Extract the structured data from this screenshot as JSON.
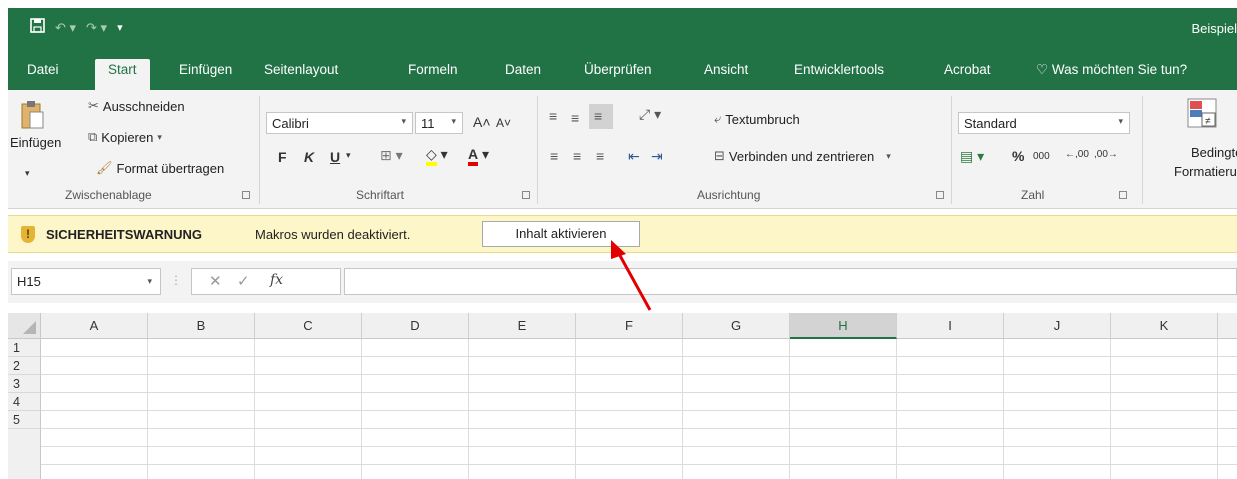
{
  "window": {
    "title": "Beispiel"
  },
  "tabs": [
    {
      "label": "Datei"
    },
    {
      "label": "Start"
    },
    {
      "label": "Einfügen"
    },
    {
      "label": "Seitenlayout"
    },
    {
      "label": "Formeln"
    },
    {
      "label": "Daten"
    },
    {
      "label": "Überprüfen"
    },
    {
      "label": "Ansicht"
    },
    {
      "label": "Entwicklertools"
    },
    {
      "label": "Acrobat"
    },
    {
      "label": "Was möchten Sie tun?"
    }
  ],
  "clipboard": {
    "group_label": "Zwischenablage",
    "paste": "Einfügen",
    "cut": "Ausschneiden",
    "copy": "Kopieren",
    "format_painter": "Format übertragen"
  },
  "font": {
    "group_label": "Schriftart",
    "name": "Calibri",
    "size": "11",
    "bold": "F",
    "italic": "K",
    "underline": "U"
  },
  "alignment": {
    "group_label": "Ausrichtung",
    "wrap_text": "Textumbruch",
    "merge_center": "Verbinden und zentrieren"
  },
  "number": {
    "group_label": "Zahl",
    "format": "Standard",
    "percent": "%",
    "thousands": "000",
    "inc_decimal": ",00",
    "dec_decimal": ",00"
  },
  "styles": {
    "conditional_format_1": "Bedingte",
    "conditional_format_2": "Formatierung"
  },
  "message_bar": {
    "title": "SICHERHEITSWARNUNG",
    "text": "Makros wurden deaktiviert.",
    "button": "Inhalt aktivieren"
  },
  "formula_bar": {
    "name_box": "H15",
    "fx": "fx",
    "formula": ""
  },
  "grid": {
    "columns": [
      "A",
      "B",
      "C",
      "D",
      "E",
      "F",
      "G",
      "H",
      "I",
      "J",
      "K"
    ],
    "selected_column": "H",
    "rows": [
      "1",
      "2",
      "3",
      "4",
      "5"
    ]
  },
  "colors": {
    "accent": "#217346",
    "message_bg": "#fdf6c8",
    "annotation_arrow": "#e00000"
  }
}
